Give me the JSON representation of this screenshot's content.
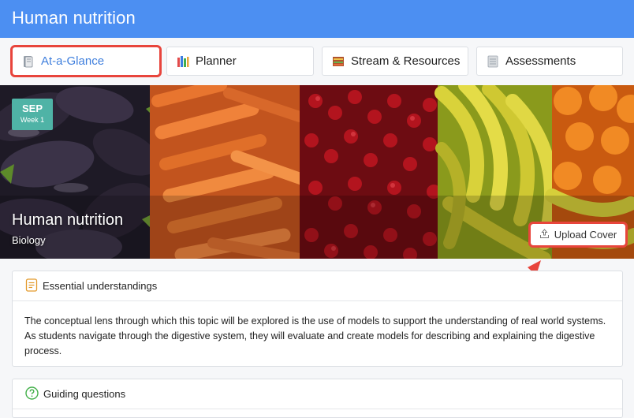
{
  "app": {
    "title": "Human nutrition"
  },
  "tabs": [
    {
      "label": "At-a-Glance",
      "icon": "book-icon",
      "active": true
    },
    {
      "label": "Planner",
      "icon": "books-icon",
      "active": false
    },
    {
      "label": "Stream & Resources",
      "icon": "stream-icon",
      "active": false
    },
    {
      "label": "Assessments",
      "icon": "stack-icon",
      "active": false
    }
  ],
  "hero": {
    "month": "SEP",
    "week": "Week 1",
    "title": "Human nutrition",
    "subtitle": "Biology",
    "upload_label": "Upload Cover"
  },
  "sections": [
    {
      "heading": "Essential understandings",
      "icon": "document-icon",
      "body": "The conceptual lens through which this topic will be explored is the use of models to support the understanding of real world systems. As students navigate through the digestive system, they will evaluate and create models for describing and explaining the digestive process."
    },
    {
      "heading": "Guiding questions",
      "icon": "question-icon"
    }
  ],
  "colors": {
    "topbar": "#4c8ff2",
    "accent_text": "#3f7fdd",
    "highlight": "#e8453c",
    "badge": "#4fb3a6"
  }
}
